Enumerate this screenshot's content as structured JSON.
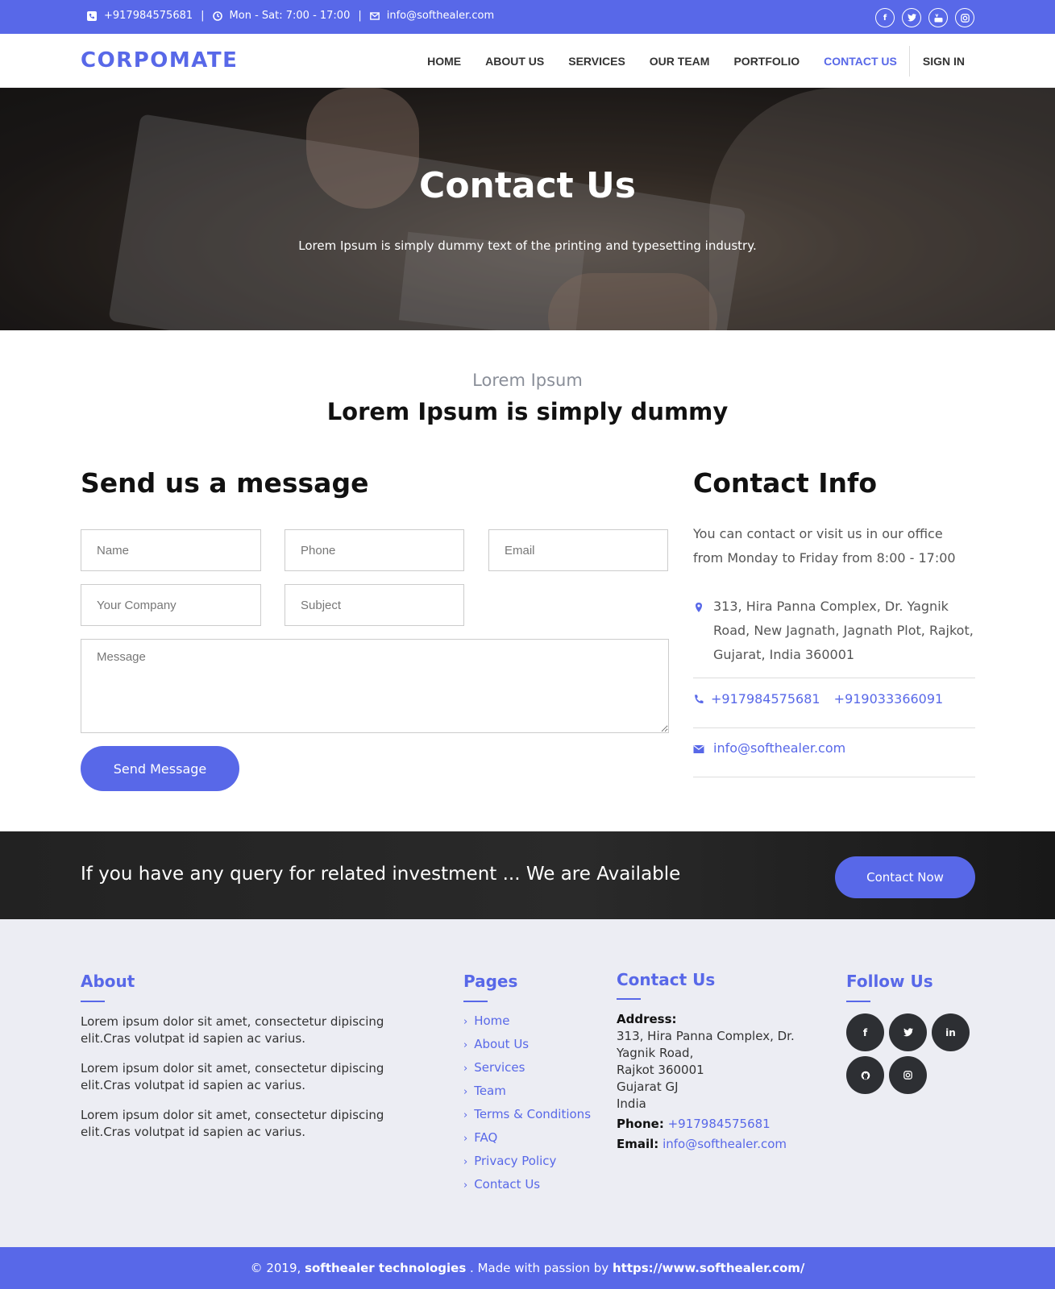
{
  "topbar": {
    "phone": "+917984575681",
    "hours": "Mon - Sat: 7:00 - 17:00",
    "email": "info@softhealer.com",
    "separator": "|",
    "social_icons": [
      "facebook-icon",
      "twitter-icon",
      "youtube-icon",
      "instagram-icon"
    ]
  },
  "brand": {
    "logo": "CORPOMATE",
    "accent": "#5868e8"
  },
  "nav": {
    "items": [
      "HOME",
      "ABOUT US",
      "SERVICES",
      "OUR TEAM",
      "PORTFOLIO",
      "CONTACT US"
    ],
    "active": "CONTACT US",
    "signin": "SIGN IN"
  },
  "hero": {
    "title": "Contact Us",
    "subtitle": "Lorem Ipsum is simply dummy text of the printing and typesetting industry."
  },
  "intro": {
    "sub": "Lorem Ipsum",
    "title": "Lorem Ipsum is simply dummy"
  },
  "form": {
    "title": "Send us a message",
    "placeholders": {
      "name": "Name",
      "phone": "Phone",
      "email": "Email",
      "company": "Your Company",
      "subject": "Subject",
      "message": "Message"
    },
    "submit": "Send Message"
  },
  "contact_info": {
    "title": "Contact Info",
    "description": "You can contact or visit us in our office from Monday to Friday from 8:00 - 17:00",
    "address": "313, Hira Panna Complex, Dr. Yagnik Road, New Jagnath, Jagnath Plot, Rajkot, Gujarat, India 360001",
    "phone1": "+917984575681",
    "phone2": "+919033366091",
    "email": "info@softhealer.com"
  },
  "cta": {
    "text": "If you have any query for related investment ... We are Available",
    "button": "Contact Now"
  },
  "footer": {
    "about": {
      "title": "About",
      "paragraphs": [
        "Lorem ipsum dolor sit amet, consectetur dipiscing elit.Cras volutpat id sapien ac varius.",
        "Lorem ipsum dolor sit amet, consectetur dipiscing elit.Cras volutpat id sapien ac varius.",
        "Lorem ipsum dolor sit amet, consectetur dipiscing elit.Cras volutpat id sapien ac varius."
      ]
    },
    "pages": {
      "title": "Pages",
      "links": [
        "Home",
        "About Us",
        "Services",
        "Team",
        "Terms & Conditions",
        "FAQ",
        "Privacy Policy",
        "Contact Us"
      ]
    },
    "contact": {
      "title": "Contact Us",
      "address_label": "Address:",
      "address_lines": [
        "313, Hira Panna Complex, Dr. Yagnik Road,",
        "Rajkot 360001",
        "Gujarat GJ",
        "India"
      ],
      "phone_label": "Phone:",
      "phone": "+917984575681",
      "email_label": "Email:",
      "email": "info@softhealer.com"
    },
    "follow": {
      "title": "Follow Us",
      "icons": [
        "facebook-icon",
        "twitter-icon",
        "linkedin-icon",
        "github-icon",
        "instagram-icon"
      ]
    }
  },
  "bottom": {
    "prefix": "© 2019,",
    "company": "softhealer technologies",
    "middle": ". Made with passion by",
    "url": "https://www.softhealer.com/"
  }
}
